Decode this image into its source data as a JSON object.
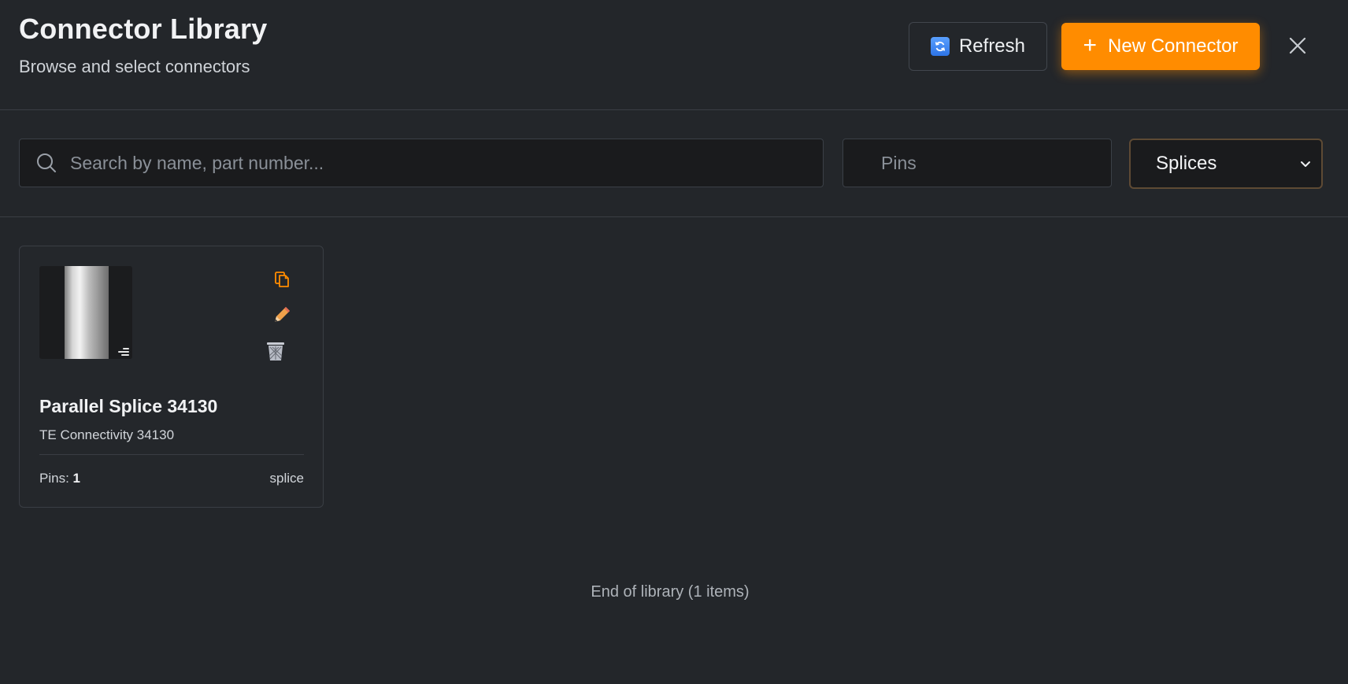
{
  "header": {
    "title": "Connector Library",
    "subtitle": "Browse and select connectors",
    "refresh_label": "Refresh",
    "refresh_icon": "refresh-icon",
    "new_label": "New Connector",
    "new_icon": "plus-icon",
    "close_icon": "close-icon",
    "accent_color": "#ff8c00"
  },
  "filters": {
    "search_placeholder": "Search by name, part number...",
    "search_value": "",
    "pins_placeholder": "Pins",
    "pins_value": "",
    "type_selected": "Splices"
  },
  "connectors": [
    {
      "name": "Parallel Splice 34130",
      "part": "TE Connectivity 34130",
      "pins_label": "Pins:",
      "pins": "1",
      "type": "splice",
      "actions": [
        "copy-icon",
        "edit-icon",
        "delete-icon"
      ]
    }
  ],
  "footer": {
    "status": "End of library (1 items)"
  }
}
